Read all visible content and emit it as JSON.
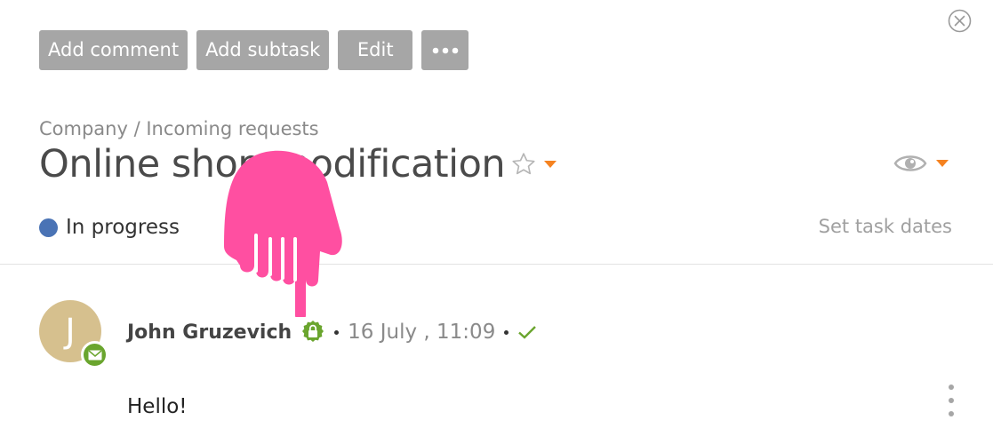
{
  "toolbar": {
    "add_comment_label": "Add comment",
    "add_subtask_label": "Add subtask",
    "edit_label": "Edit",
    "more_icon": "more-horizontal-icon"
  },
  "task": {
    "breadcrumb": "Company / Incoming requests",
    "title": "Online shop modification",
    "status_label": "In progress",
    "status_color": "#4a73b5",
    "set_dates_label": "Set task dates"
  },
  "comment": {
    "avatar_initial": "J",
    "avatar_color": "#d6c08e",
    "badge_color": "#6aa52e",
    "author": "John Gruzevich",
    "time": "16 July , 11:09",
    "text": "Hello!"
  },
  "colors": {
    "accent_orange": "#f58220",
    "button_gray": "#a6a6a6",
    "check_green": "#6aa52e",
    "pointer_pink": "#ff4fa1"
  }
}
